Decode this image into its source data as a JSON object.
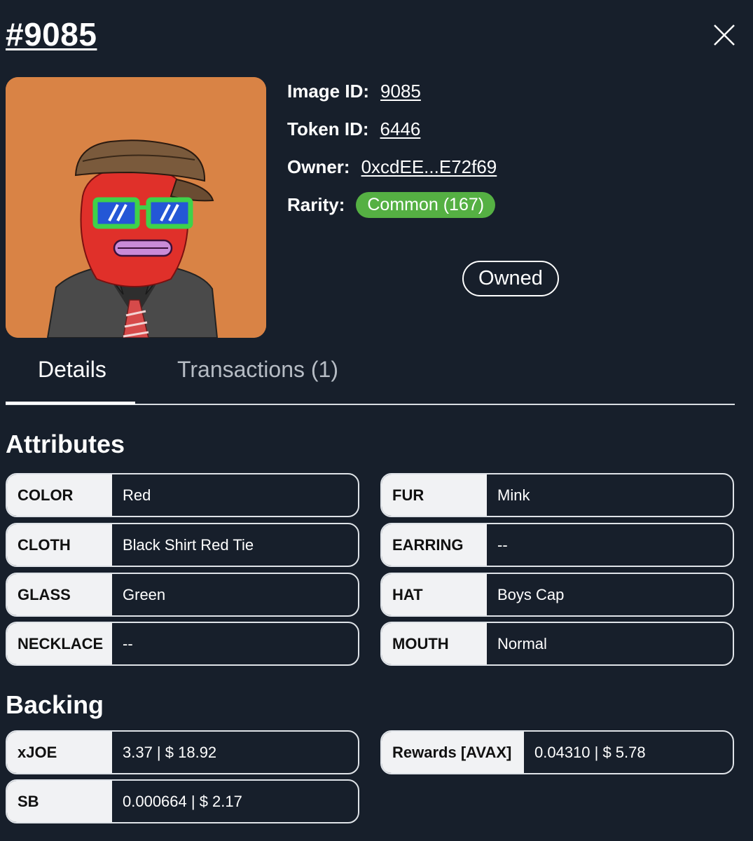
{
  "header": {
    "title": "#9085"
  },
  "info": {
    "image_id_label": "Image ID:",
    "image_id": "9085",
    "token_id_label": "Token ID:",
    "token_id": "6446",
    "owner_label": "Owner:",
    "owner": "0xcdEE...E72f69",
    "rarity_label": "Rarity:",
    "rarity": "Common (167)",
    "rarity_color": "#55b043"
  },
  "owned_button": "Owned",
  "tabs": [
    {
      "label": "Details",
      "active": true
    },
    {
      "label": "Transactions (1)",
      "active": false
    }
  ],
  "attributes": {
    "heading": "Attributes",
    "items": [
      {
        "key": "COLOR",
        "value": "Red"
      },
      {
        "key": "FUR",
        "value": "Mink"
      },
      {
        "key": "CLOTH",
        "value": "Black Shirt Red Tie"
      },
      {
        "key": "EARRING",
        "value": "--"
      },
      {
        "key": "GLASS",
        "value": "Green"
      },
      {
        "key": "HAT",
        "value": "Boys Cap"
      },
      {
        "key": "NECKLACE",
        "value": "--"
      },
      {
        "key": "MOUTH",
        "value": "Normal"
      }
    ]
  },
  "backing": {
    "heading": "Backing",
    "items": [
      {
        "key": "xJOE",
        "value": "3.37 | $ 18.92"
      },
      {
        "key": "Rewards [AVAX]",
        "value": "0.04310 | $ 5.78"
      },
      {
        "key": "SB",
        "value": "0.000664 | $ 2.17"
      }
    ]
  },
  "colors": {
    "background": "#171f2b",
    "image_background": "#d98345",
    "accent_green": "#55b043"
  }
}
